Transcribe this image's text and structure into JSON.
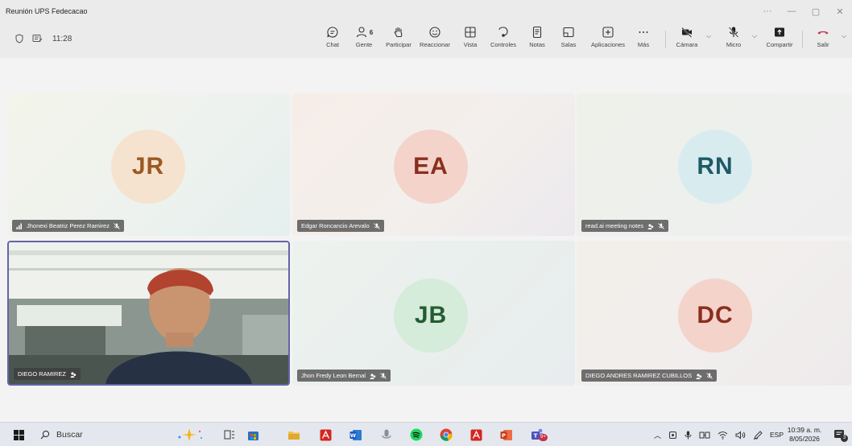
{
  "window": {
    "title": "Reunión UPS Fedecacao",
    "controls": [
      "···",
      "—",
      "▢",
      "✕"
    ]
  },
  "toolbar": {
    "time": "11:28",
    "people_count": "6",
    "buttons": {
      "chat": "Chat",
      "people": "Gente",
      "raise": "Participar",
      "react": "Reaccionar",
      "view": "Vista",
      "controls": "Controles",
      "notes": "Notas",
      "rooms": "Salas",
      "apps": "Aplicaciones",
      "more": "Más",
      "camera": "Cámara",
      "mic": "Micro",
      "share": "Compartir",
      "leave": "Salir"
    }
  },
  "participants": [
    {
      "initials": "JR",
      "name": "Jhonexi Beatriz Perez Ramirez"
    },
    {
      "initials": "EA",
      "name": "Edgar Roncancio Arevalo"
    },
    {
      "initials": "RN",
      "name": "read.ai meeting notes"
    },
    {
      "initials": "",
      "name": "DIEGO RAMIREZ"
    },
    {
      "initials": "JB",
      "name": "Jhon Fredy Leon Bernal"
    },
    {
      "initials": "DC",
      "name": "DIEGO ANDRES RAMIREZ CUBILLOS"
    }
  ],
  "taskbar": {
    "search_placeholder": "Buscar",
    "teams_badge": "9+",
    "language": "ESP",
    "clock_time": "10:39 a. m.",
    "clock_date": "8/05/2026",
    "notification_count": "3"
  },
  "colors": {
    "avatar_jr_bg": "#f6e3cf",
    "avatar_jr_fg": "#9a5a22",
    "avatar_ea_bg": "#f4d3cb",
    "avatar_ea_fg": "#8a2e1e",
    "avatar_rn_bg": "#d8ecef",
    "avatar_rn_fg": "#1f5a66",
    "avatar_jb_bg": "#d4ecd9",
    "avatar_jb_fg": "#235c33",
    "avatar_dc_bg": "#f4d3cb",
    "avatar_dc_fg": "#8a2e1e",
    "leave_red": "#c4314b",
    "active_border": "#6264a7"
  }
}
